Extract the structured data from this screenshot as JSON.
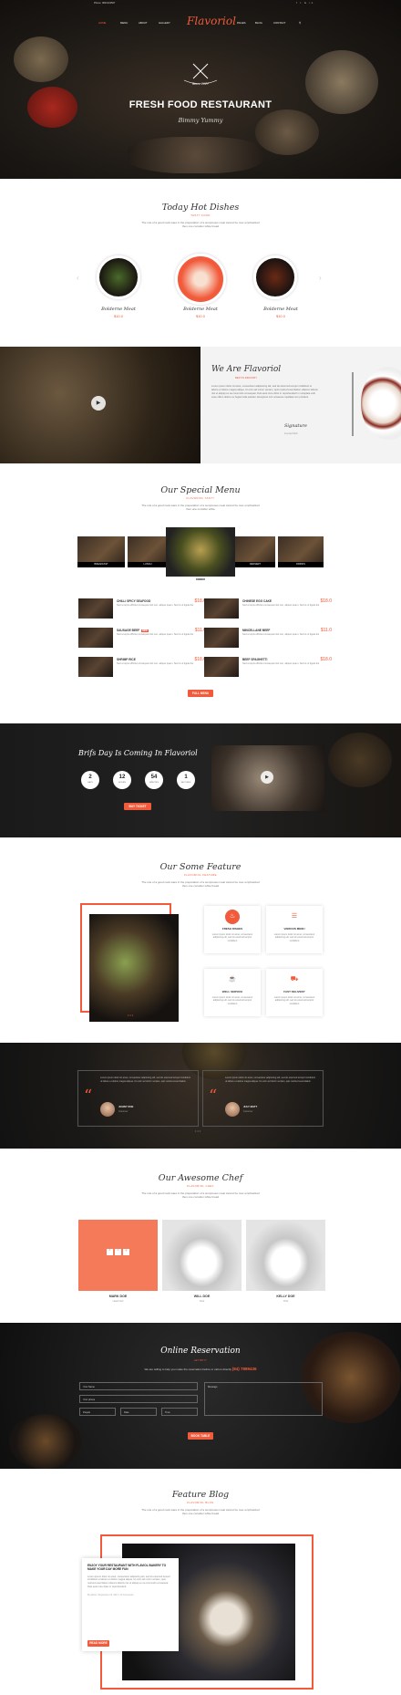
{
  "topbar": {
    "phone": "Phone: 0831234567",
    "icons": "f  t  G  in"
  },
  "nav": {
    "items": [
      "HOME",
      "MENU",
      "ABOUT",
      "GALLERY",
      "PAGES",
      "BLOG",
      "CONTACT"
    ],
    "logo": "Flavoriol"
  },
  "hero": {
    "since": "Since",
    "year": "2017",
    "title": "FRESH FOOD RESTAURANT",
    "subtitle": "Bimmy Yummy"
  },
  "hot": {
    "title": "Today Hot Dishes",
    "sub": "TASTY FOOD",
    "desc": "The role of a good cook ware in the preparation of a sumptuous meal cannot be over emphasized then one consider white bread",
    "dishes": [
      {
        "name": "Bolderne Meat",
        "price": "$10.0"
      },
      {
        "name": "Bolderne Meat",
        "price": "$10.0"
      },
      {
        "name": "Bolderne Meat",
        "price": "$10.0"
      }
    ]
  },
  "about": {
    "title": "We Are Flavoriol",
    "sub": "BEST IN INDUSTRY",
    "text": "Lorem ipsum dolor sit amet, consectetur adipisicing elit, sed do eiusmod tempor incididunt ut labore et dolore magna aliqua. Ut enim ad minim veniam, quis nostrud exercitation ullamco laboris nisi ut aliquip ex ea commodo consequat. Duis aute irure dolor in reprehenderit in voluptate velit esse cillum dolore eu fugiat nulla pariatur. Excepteur sint occaecat cupidatat non proident.",
    "signature": "Signature",
    "role": "Founder/CEO"
  },
  "menu": {
    "title": "Our Special Menu",
    "sub": "FLAVORIOL TASTY",
    "desc": "The role of a good cook ware in the preparation of a sumptuous meal cannot be over emphasized then one consider white",
    "tabs": [
      "BREAKFAST",
      "LUNCH",
      "DINNER",
      "DESSERT",
      "DRINKS"
    ],
    "items": [
      {
        "name": "CHILLI SPICY SEAFOOD",
        "price": "$18.0",
        "desc": "Sed a turpis efficitur,consequat nisl non, aliquet quam. Sed ut ut ligula dui",
        "isnew": ""
      },
      {
        "name": "CHINESE EGG CAKE",
        "price": "$18.0",
        "desc": "Sed a turpis efficitur,consequat nisl non, aliquet quam. Sed ut ut ligula dui",
        "isnew": ""
      },
      {
        "name": "SAUSAGE BEEF",
        "price": "$11.0",
        "desc": "Sed a turpis efficitur,consequat nisl non, aliquet quam. Sed ut ut ligula dui",
        "isnew": "NEW"
      },
      {
        "name": "MINCELLANE BEEF",
        "price": "$11.0",
        "desc": "Sed a turpis efficitur,consequat nisl non, aliquet quam. Sed ut ut ligula dui",
        "isnew": ""
      },
      {
        "name": "SHRIMP RICE",
        "price": "$18.0",
        "desc": "Sed a turpis efficitur,consequat nisl non, aliquet quam. Sed ut ut ligula dui",
        "isnew": ""
      },
      {
        "name": "BEEF SPAGHETTI",
        "price": "$18.0",
        "desc": "Sed a turpis efficitur,consequat nisl non, aliquet quam. Sed ut ut ligula dui",
        "isnew": ""
      }
    ],
    "button": "FULL MENU"
  },
  "bday": {
    "title": "Brifs Day Is Coming In Flavoriol",
    "counters": [
      {
        "n": "2",
        "l": "DAYS"
      },
      {
        "n": "12",
        "l": "HOURS"
      },
      {
        "n": "54",
        "l": "MINUTES"
      },
      {
        "n": "1",
        "l": "SECONDS"
      }
    ],
    "button": "BUY TICKET"
  },
  "features": {
    "title": "Our Some Feature",
    "sub": "FLAVORIOL FEATURE",
    "desc": "The role of a good cook ware in the preparation of a sumptuous meal cannot be over emphasized then one consider white bread",
    "items": [
      {
        "title": "FRESH DISHES",
        "desc": "Lorem ipsum dolor sit amet, consectetur adipiscing elit, sed do eiusmod tempor incididunt"
      },
      {
        "title": "VARIOUS MENU",
        "desc": "Lorem ipsum dolor sit amet, consectetur adipiscing elit, sed do eiusmod tempor incididunt"
      },
      {
        "title": "WELL SERVICE",
        "desc": "Lorem ipsum dolor sit amet, consectetur adipiscing elit, sed do eiusmod tempor incididunt"
      },
      {
        "title": "FAST DELIVERY",
        "desc": "Lorem ipsum dolor sit amet, consectetur adipiscing elit, sed do eiusmod tempor incididunt"
      }
    ]
  },
  "testimonials": [
    {
      "text": "Lorem ipsum dolor sit amet, consectetur adipiscing elit, sed do eiusmod tempor incididunt ut labore et dolore magna aliqua. Ut enim ad minim veniam, quis nostrud exercitation",
      "name": "JOHNY DOE",
      "role": "Customer"
    },
    {
      "text": "Lorem ipsum dolor sit amet, consectetur adipiscing elit, sed do eiusmod tempor incididunt ut labore et dolore magna aliqua. Ut enim ad minim veniam, quis nostrud exercitation",
      "name": "JULY MATT",
      "role": "Customer"
    }
  ],
  "chefs": {
    "title": "Our Awesome Chef",
    "sub": "FLAVORIOL CHEF",
    "desc": "The role of a good cook ware in the preparation of a sumptuous meal cannot be over emphasized then one consider white bread",
    "items": [
      {
        "name": "MARK DOE",
        "role": "Head chef"
      },
      {
        "name": "WILL DOE",
        "role": "Chef"
      },
      {
        "name": "KELLY DOE",
        "role": "Chef"
      }
    ]
  },
  "reservation": {
    "title": "Online Reservation",
    "sub": "LET TRY IT",
    "note": "We are willing to help you make the reservation before or call us directly",
    "phone": "(84) 7889436",
    "name": "Your Name",
    "phone_ph": "Your phone",
    "message": "Message",
    "people": "People",
    "date": "Date",
    "time": "Time",
    "button": "BOOK TABLE"
  },
  "blog": {
    "title": "Feature Blog",
    "sub": "FLAVORIOL BLOG",
    "desc": "The role of a good cook ware in the preparation of a sumptuous meal cannot be over emphasized then one consider white bread",
    "post": {
      "title": "ENJOY YOUR RESTAURANT WITH FLAVIOL BAKERY TO MAKE YOUR DAY MORE FUN",
      "text": "Lorem ipsum dolor sit amet, consectetur adipiscing elit, sed do eiusmod tempor incididunt ut labore et dolore magna aliqua. Ut enim ad minim veniam, quis nostrud exercitation ullamco laboris nisi ut aliquip ex ea commodo consequat. Duis aute irure dolor in reprehenderit.",
      "meta": "By Admin   |   September 23, 2017   |   10 Comments",
      "button": "READ MORE"
    }
  }
}
